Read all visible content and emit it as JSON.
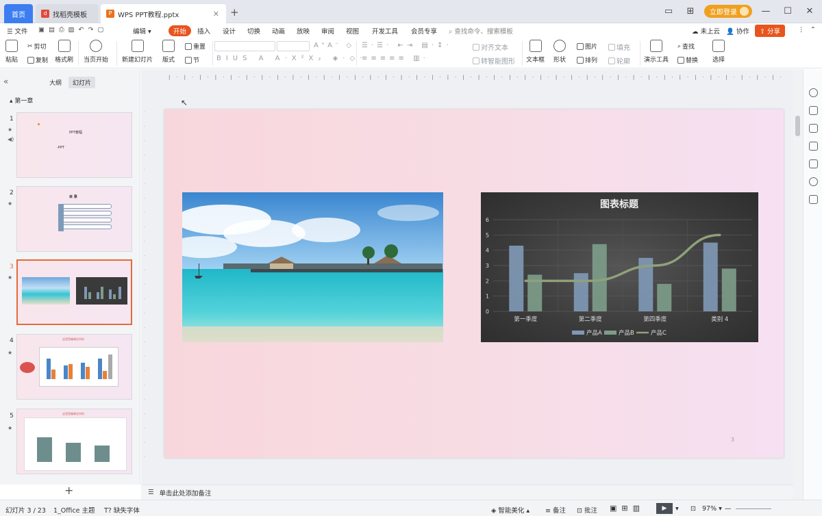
{
  "tabs": {
    "home": "首页",
    "template": "找稻壳模板",
    "doc": "WPS PPT教程.pptx",
    "new": "+"
  },
  "titlebar": {
    "login": "立即登录"
  },
  "menu": {
    "file": "文件",
    "edit": "编辑",
    "items": [
      "开始",
      "插入",
      "设计",
      "切换",
      "动画",
      "放映",
      "审阅",
      "视图",
      "开发工具",
      "会员专享"
    ],
    "search_placeholder": "查找命令、搜索模板",
    "cloud": "未上云",
    "collab": "协作",
    "share": "分享"
  },
  "ribbon": {
    "paste": "粘贴",
    "cut": "剪切",
    "copy": "复制",
    "format_painter": "格式刷",
    "from_start": "当页开始",
    "new_slide": "新建幻灯片",
    "layout": "版式",
    "section": "节",
    "reset": "重置",
    "align_text": "对齐文本",
    "smartart": "转智能图形",
    "textbox": "文本框",
    "shape": "形状",
    "picture": "图片",
    "arrange": "排列",
    "fill": "填充",
    "outline": "轮廓",
    "present_tools": "演示工具",
    "find": "查找",
    "replace": "替换",
    "select": "选择"
  },
  "panel": {
    "outline_tab": "大纲",
    "slides_tab": "幻灯片",
    "section_title": "第一章",
    "add_slide": "+",
    "slides": [
      {
        "num": "1",
        "title": "PPT教程",
        "sub": "-PPT"
      },
      {
        "num": "2",
        "title": "目 录"
      },
      {
        "num": "3"
      },
      {
        "num": "4",
        "title": "这是是编辑业所的"
      },
      {
        "num": "5",
        "title": "这是是编辑业所的"
      }
    ]
  },
  "slide": {
    "number": "3"
  },
  "chart_data": {
    "type": "bar+line",
    "title": "图表标题",
    "categories": [
      "第一季度",
      "第二季度",
      "第四季度",
      "类别 4"
    ],
    "ylim": [
      0,
      6
    ],
    "yticks": [
      0,
      1,
      2,
      3,
      4,
      5,
      6
    ],
    "series": [
      {
        "name": "产品A",
        "type": "bar",
        "values": [
          4.3,
          2.5,
          3.5,
          4.5
        ],
        "color": "#7f98b5"
      },
      {
        "name": "产品B",
        "type": "bar",
        "values": [
          2.4,
          4.4,
          1.8,
          2.8
        ],
        "color": "#7d9c8a"
      },
      {
        "name": "产品C",
        "type": "line",
        "values": [
          2.0,
          2.0,
          3.0,
          5.0
        ],
        "color": "#8fa17a"
      }
    ],
    "grid": true,
    "legend": "bottom"
  },
  "notes": {
    "placeholder": "单击此处添加备注"
  },
  "status": {
    "slide_info": "幻灯片 3 / 23",
    "theme": "1_Office 主题",
    "missing_fonts": "缺失字体",
    "beautify": "智能美化",
    "notes": "备注",
    "comments": "批注",
    "zoom": "97%"
  }
}
